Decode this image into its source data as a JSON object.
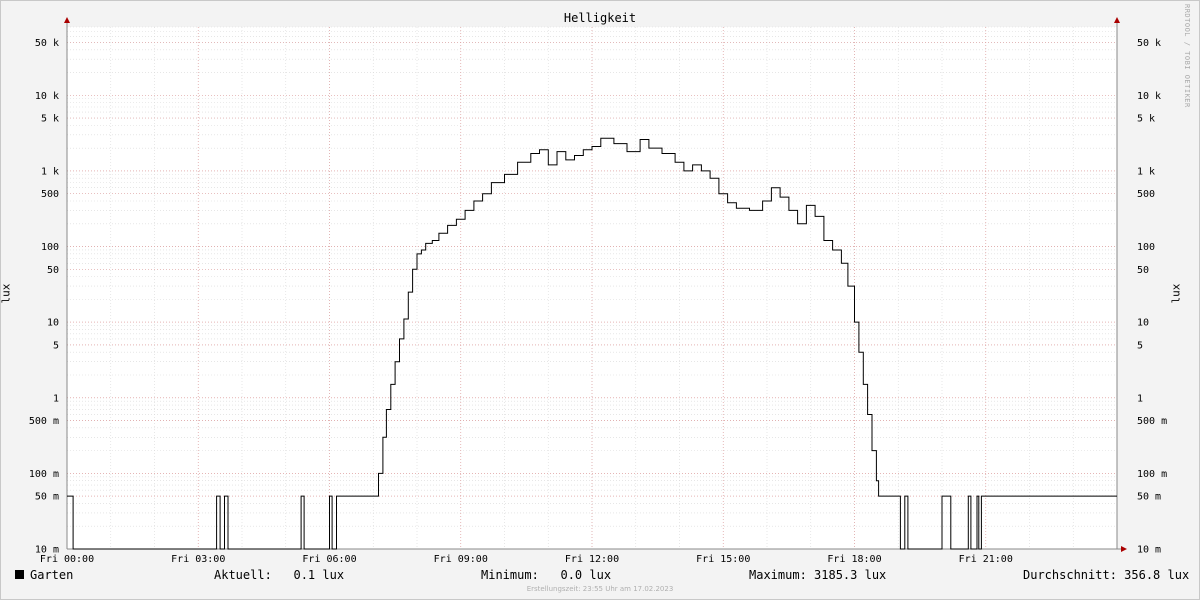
{
  "chart_data": {
    "type": "line",
    "title": "Helligkeit",
    "ylabel": "lux",
    "yscale": "log",
    "ylim": [
      0.01,
      80000
    ],
    "xlim_hours": [
      0,
      24
    ],
    "x_tick_labels": [
      "Fri 00:00",
      "Fri 03:00",
      "Fri 06:00",
      "Fri 09:00",
      "Fri 12:00",
      "Fri 15:00",
      "Fri 18:00",
      "Fri 21:00"
    ],
    "y_ticks": [
      {
        "value": 0.01,
        "label": "10 m"
      },
      {
        "value": 0.05,
        "label": "50 m"
      },
      {
        "value": 0.1,
        "label": "100 m"
      },
      {
        "value": 0.5,
        "label": "500 m"
      },
      {
        "value": 1,
        "label": "1"
      },
      {
        "value": 5,
        "label": "5"
      },
      {
        "value": 10,
        "label": "10"
      },
      {
        "value": 50,
        "label": "50"
      },
      {
        "value": 100,
        "label": "100"
      },
      {
        "value": 500,
        "label": "500"
      },
      {
        "value": 1000,
        "label": "1 k"
      },
      {
        "value": 5000,
        "label": "5 k"
      },
      {
        "value": 10000,
        "label": "10 k"
      },
      {
        "value": 50000,
        "label": "50 k"
      }
    ],
    "grid": true,
    "legend_position": "bottom",
    "colors": {
      "line": "#000000",
      "major_grid": "#e0a0a0",
      "minor_grid": "#d8d8d8",
      "axis": "#888888",
      "arrow": "#aa0000",
      "plot_bg": "#ffffff"
    },
    "series": [
      {
        "name": "Garten",
        "points": [
          [
            0.0,
            0.05
          ],
          [
            0.14,
            0.01
          ],
          [
            3.42,
            0.05
          ],
          [
            3.5,
            0.01
          ],
          [
            3.6,
            0.05
          ],
          [
            3.68,
            0.01
          ],
          [
            5.35,
            0.05
          ],
          [
            5.42,
            0.01
          ],
          [
            6.0,
            0.05
          ],
          [
            6.06,
            0.01
          ],
          [
            6.16,
            0.05
          ],
          [
            7.0,
            0.05
          ],
          [
            7.12,
            0.1
          ],
          [
            7.22,
            0.3
          ],
          [
            7.3,
            0.7
          ],
          [
            7.4,
            1.5
          ],
          [
            7.5,
            3
          ],
          [
            7.6,
            6
          ],
          [
            7.7,
            11
          ],
          [
            7.8,
            25
          ],
          [
            7.9,
            50
          ],
          [
            8.0,
            80
          ],
          [
            8.1,
            90
          ],
          [
            8.2,
            110
          ],
          [
            8.35,
            120
          ],
          [
            8.5,
            150
          ],
          [
            8.7,
            190
          ],
          [
            8.9,
            230
          ],
          [
            9.1,
            300
          ],
          [
            9.3,
            400
          ],
          [
            9.5,
            500
          ],
          [
            9.7,
            700
          ],
          [
            10.0,
            900
          ],
          [
            10.3,
            1300
          ],
          [
            10.6,
            1700
          ],
          [
            10.8,
            1900
          ],
          [
            11.0,
            1200
          ],
          [
            11.2,
            1800
          ],
          [
            11.4,
            1400
          ],
          [
            11.6,
            1600
          ],
          [
            11.8,
            1900
          ],
          [
            12.0,
            2100
          ],
          [
            12.2,
            2700
          ],
          [
            12.5,
            2300
          ],
          [
            12.8,
            1800
          ],
          [
            13.1,
            2600
          ],
          [
            13.3,
            2000
          ],
          [
            13.6,
            1700
          ],
          [
            13.9,
            1300
          ],
          [
            14.1,
            1000
          ],
          [
            14.3,
            1200
          ],
          [
            14.5,
            1000
          ],
          [
            14.7,
            800
          ],
          [
            14.9,
            500
          ],
          [
            15.1,
            380
          ],
          [
            15.3,
            320
          ],
          [
            15.6,
            300
          ],
          [
            15.9,
            400
          ],
          [
            16.1,
            600
          ],
          [
            16.3,
            450
          ],
          [
            16.5,
            300
          ],
          [
            16.7,
            200
          ],
          [
            16.9,
            350
          ],
          [
            17.1,
            250
          ],
          [
            17.3,
            120
          ],
          [
            17.5,
            90
          ],
          [
            17.7,
            60
          ],
          [
            17.85,
            30
          ],
          [
            18.0,
            10
          ],
          [
            18.1,
            4
          ],
          [
            18.2,
            1.5
          ],
          [
            18.3,
            0.6
          ],
          [
            18.4,
            0.2
          ],
          [
            18.5,
            0.08
          ],
          [
            18.55,
            0.05
          ],
          [
            19.0,
            0.05
          ],
          [
            19.05,
            0.01
          ],
          [
            19.15,
            0.05
          ],
          [
            19.22,
            0.01
          ],
          [
            20.0,
            0.05
          ],
          [
            20.2,
            0.01
          ],
          [
            20.6,
            0.05
          ],
          [
            20.66,
            0.01
          ],
          [
            20.8,
            0.05
          ],
          [
            20.84,
            0.01
          ],
          [
            20.9,
            0.05
          ],
          [
            24.0,
            0.05
          ]
        ]
      }
    ]
  },
  "legend": {
    "series_name": "Garten",
    "current": "Aktuell:   0.1 lux",
    "minimum": "Minimum:   0.0 lux",
    "maximum": "Maximum: 3185.3 lux",
    "average": "Durchschnitt: 356.8 lux"
  },
  "footer": "Erstellungszeit: 23:55 Uhr am 17.02.2023",
  "watermark": "RRDTOOL / TOBI OETIKER"
}
